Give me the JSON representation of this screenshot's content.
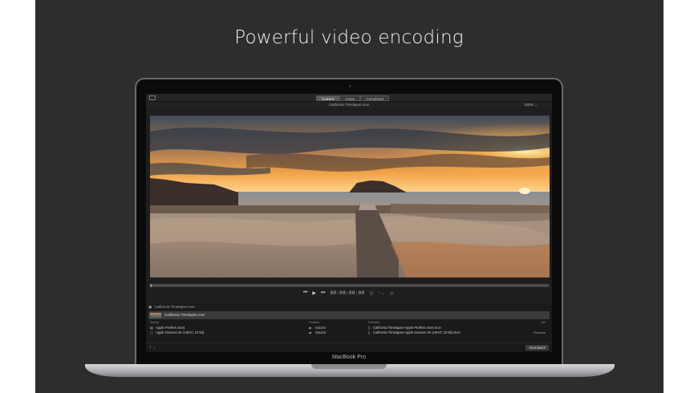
{
  "headline": "Powerful video encoding",
  "device_label": "MacBook Pro",
  "app": {
    "tabs": [
      {
        "label": "Current",
        "active": true
      },
      {
        "label": "Active",
        "active": false
      },
      {
        "label": "Completed",
        "active": false
      }
    ],
    "file_title": "California Timelapse.mov",
    "zoom": "100%",
    "timecode": "00:00:00:00",
    "scrub_progress": 0.0,
    "source": {
      "label": "California Timelapse.mov"
    },
    "job": {
      "label": "California Timelapse.mov"
    },
    "columns": {
      "setting": "Setting",
      "location": "Location",
      "filename": "Filename"
    },
    "add_label": "add",
    "outputs": [
      {
        "setting": "Apple ProRes 4444",
        "location": "Source",
        "filename": "California Timelapse-Apple ProRes 4444.mov"
      },
      {
        "setting": "Apple Devices 4K (HEVC 10-bit)",
        "location": "Source",
        "filename": "California Timelapse-Apple Devices 4K (HEVC 10-bit).m4v"
      }
    ],
    "remove_label": "Remove",
    "add_button": "+ ⌄",
    "start_batch": "Start Batch"
  },
  "colors": {
    "background": "#2d2d2d",
    "accent_sun": "#f4a33a"
  }
}
